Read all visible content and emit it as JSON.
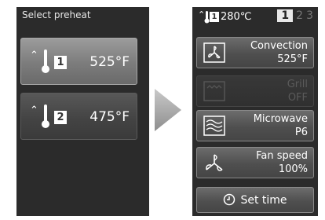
{
  "left_panel": {
    "title": "Select preheat",
    "presets": [
      {
        "index": "1",
        "temperature": "525°F",
        "icon": "thermometer-icon"
      },
      {
        "index": "2",
        "temperature": "475°F",
        "icon": "thermometer-icon"
      }
    ]
  },
  "right_panel": {
    "status": {
      "preset_index": "1",
      "current_temperature": "280℃"
    },
    "pages": [
      "1",
      "2",
      "3"
    ],
    "active_page": "1",
    "functions": [
      {
        "label": "Convection",
        "value": "525°F",
        "icon": "fan-icon",
        "enabled": true
      },
      {
        "label": "Grill",
        "value": "OFF",
        "icon": "grill-icon",
        "enabled": false
      },
      {
        "label": "Microwave",
        "value": "P6",
        "icon": "microwave-icon",
        "enabled": true
      },
      {
        "label": "Fan speed",
        "value": "100%",
        "icon": "fan-icon",
        "enabled": true
      }
    ],
    "set_time": {
      "label": "Set time",
      "icon": "clock-icon"
    }
  },
  "colors": {
    "screen_bg": "#2b2b2b",
    "button_active": "#8c8c8c",
    "text": "#ffffff"
  }
}
